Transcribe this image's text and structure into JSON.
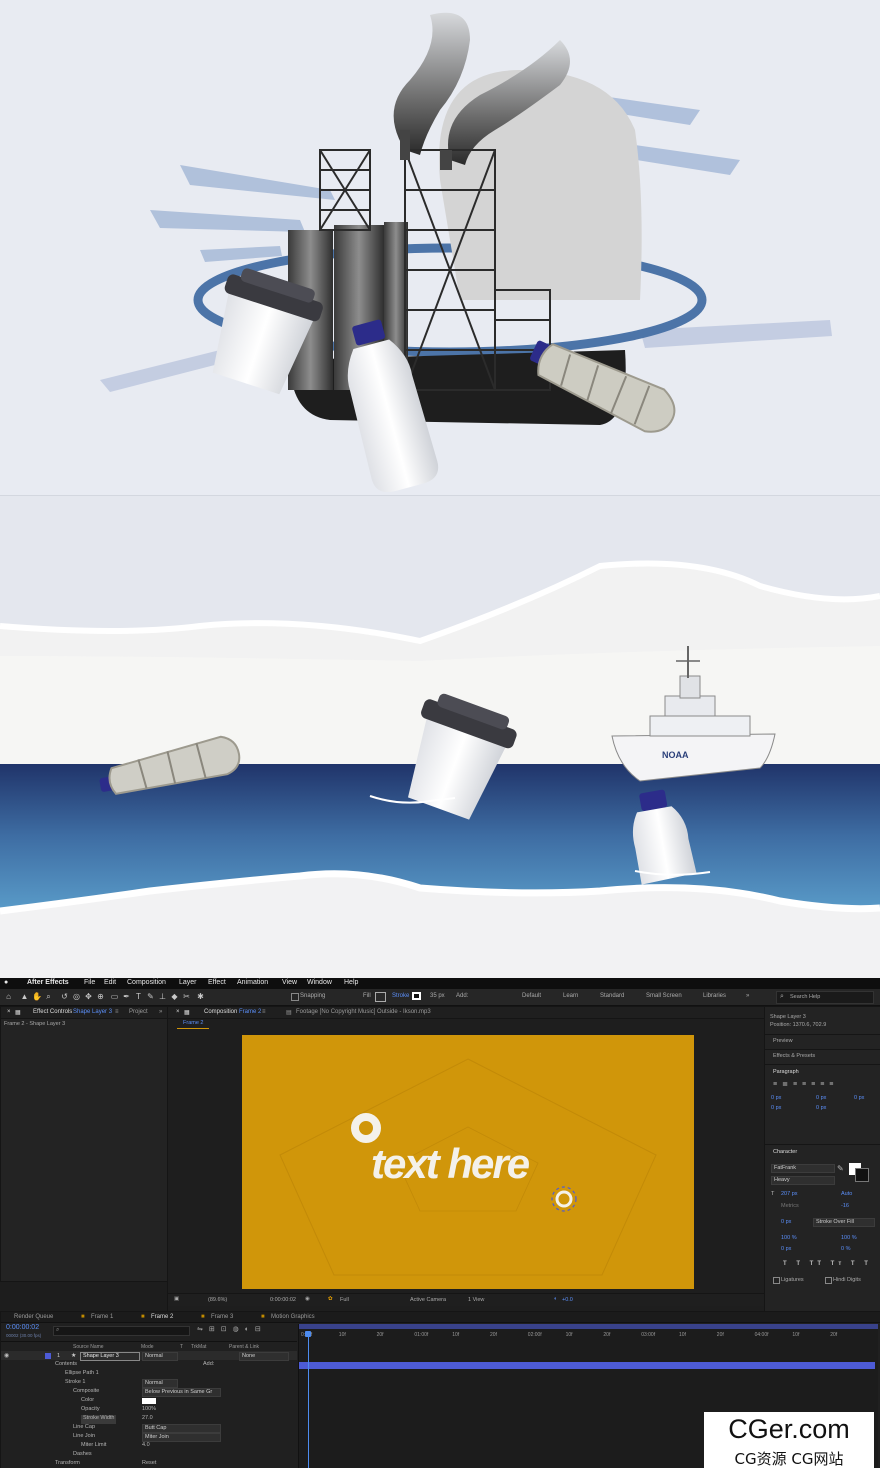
{
  "app": {
    "menu": [
      "After Effects",
      "File",
      "Edit",
      "Composition",
      "Layer",
      "Effect",
      "Animation",
      "View",
      "Window",
      "Help"
    ],
    "toolbar": {
      "snapping": "Snapping",
      "fill": "Fill",
      "stroke": "Stroke",
      "stroke_width": "35 px",
      "add": "Add:",
      "workspaces": [
        "Default",
        "Learn",
        "Standard",
        "Small Screen",
        "Libraries"
      ],
      "search": "Search Help"
    }
  },
  "left_panel": {
    "tab": "Effect Controls",
    "tab_layer": "Shape Layer 3",
    "project_tab": "Project",
    "subtitle": "Frame 2 - Shape Layer 3"
  },
  "comp_panel": {
    "tab": "Composition",
    "tab_comp": "Frame 2",
    "footage_tab": "Footage [No Copyright Music] Outside - Ikson.mp3",
    "breadcrumb": "Frame 2",
    "canvas_text": "text here",
    "canvas_bg": "#d0960a",
    "footer": {
      "zoom": "(89.6%)",
      "timecode": "0:00:00:02",
      "resolution": "Full",
      "camera": "Active Camera",
      "views": "1 View",
      "exposure": "+0.0"
    }
  },
  "right_panel": {
    "info_layer": "Shape Layer 3",
    "info_position": "Position: 1370.6, 702.9",
    "preview": "Preview",
    "effects": "Effects & Presets",
    "paragraph": "Paragraph",
    "para_values": [
      "0 px",
      "0 px",
      "0 px",
      "0 px",
      "0 px"
    ],
    "character": "Character",
    "font": "FatFrank",
    "style": "Heavy",
    "font_size": "207 px",
    "leading": "Auto",
    "kerning": "Metrics",
    "tracking": "-16",
    "stroke_size": "0 px",
    "stroke_mode": "Stroke Over Fill",
    "vscale": "100 %",
    "hscale": "100 %",
    "baseline": "0 px",
    "tsume": "0 %",
    "ligatures": "Ligatures",
    "hindi": "Hindi Digits"
  },
  "timeline": {
    "tabs": [
      "Render Queue",
      "Frame 1",
      "Frame 2",
      "Frame 3",
      "Motion Graphics"
    ],
    "timecode": "0:00:00:02",
    "fps": "00002 (30.00 fps)",
    "columns": {
      "source": "Source Name",
      "mode": "Mode",
      "t": "T",
      "trkmat": "TrkMat",
      "parent": "Parent & Link"
    },
    "ruler": [
      "0:00f",
      "10f",
      "20f",
      "01:00f",
      "10f",
      "20f",
      "02:00f",
      "10f",
      "20f",
      "03:00f",
      "10f",
      "20f",
      "04:00f",
      "10f",
      "20f"
    ],
    "layer": {
      "num": "1",
      "name": "Shape Layer 3",
      "mode": "Normal",
      "parent": "None"
    },
    "props": [
      {
        "label": "Contents",
        "indent": 1,
        "value": ""
      },
      {
        "label": "Ellipse Path 1",
        "indent": 2,
        "value": ""
      },
      {
        "label": "Stroke 1",
        "indent": 2,
        "value": "Normal"
      },
      {
        "label": "Composite",
        "indent": 3,
        "value": "Below Previous in Same Gr"
      },
      {
        "label": "Color",
        "indent": 3,
        "value": ""
      },
      {
        "label": "Opacity",
        "indent": 3,
        "value": "100%"
      },
      {
        "label": "Stroke Width",
        "indent": 3,
        "value": "27.0"
      },
      {
        "label": "Line Cap",
        "indent": 3,
        "value": "Butt Cap"
      },
      {
        "label": "Line Join",
        "indent": 3,
        "value": "Miter Join"
      },
      {
        "label": "Miter Limit",
        "indent": 3,
        "value": "4.0"
      },
      {
        "label": "Dashes",
        "indent": 2,
        "value": ""
      },
      {
        "label": "Transform",
        "indent": 1,
        "value": "Reset"
      }
    ],
    "add_label": "Add:"
  },
  "watermark": {
    "title": "CGer.com",
    "subtitle": "CG资源 CG网站"
  },
  "scene2": {
    "ship_label": "NOAA"
  }
}
